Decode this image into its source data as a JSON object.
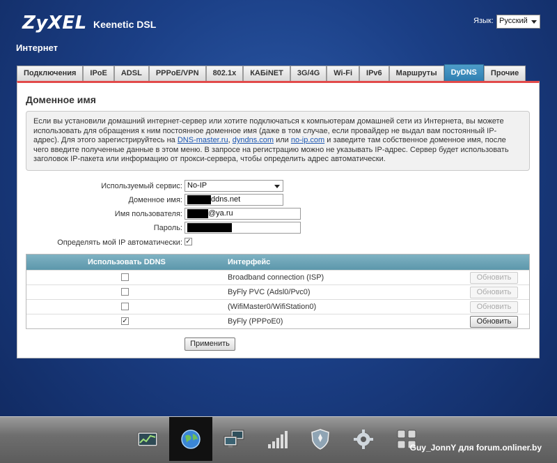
{
  "header": {
    "brand": "ZyXEL",
    "product": "Keenetic DSL",
    "language_label": "Язык:",
    "language_value": "Русский"
  },
  "page_title": "Интернет",
  "tabs": [
    {
      "label": "Подключения",
      "active": false
    },
    {
      "label": "IPoE",
      "active": false
    },
    {
      "label": "ADSL",
      "active": false
    },
    {
      "label": "PPPoE/VPN",
      "active": false
    },
    {
      "label": "802.1x",
      "active": false
    },
    {
      "label": "КАБiNET",
      "active": false
    },
    {
      "label": "3G/4G",
      "active": false
    },
    {
      "label": "Wi-Fi",
      "active": false
    },
    {
      "label": "IPv6",
      "active": false
    },
    {
      "label": "Маршруты",
      "active": false
    },
    {
      "label": "DyDNS",
      "active": true
    },
    {
      "label": "Прочие",
      "active": false
    }
  ],
  "panel": {
    "title": "Доменное имя",
    "info": {
      "text_1": "Если вы установили домашний интернет-сервер или хотите подключаться к компьютерам домашней сети из Интернета, вы можете использовать для обращения к ним постоянное доменное имя (даже в том случае, если провайдер не выдал вам постоянный IP-адрес). Для этого зарегистрируйтесь на ",
      "link_1": "DNS-master.ru",
      "sep_1": ", ",
      "link_2": "dyndns.com",
      "sep_2": " или ",
      "link_3": "no-ip.com",
      "text_2": " и заведите там собственное доменное имя, после чего введите полученные данные в этом меню. В запросе на регистрацию можно не указывать IP-адрес. Сервер будет использовать заголовок IP-пакета или информацию от прокси-сервера, чтобы определить адрес автоматически."
    },
    "form": {
      "service_label": "Используемый сервис:",
      "service_value": "No-IP",
      "domain_label": "Доменное имя:",
      "domain_suffix": "ddns.net",
      "username_label": "Имя пользователя:",
      "username_suffix": "@ya.ru",
      "password_label": "Пароль:",
      "auto_ip_label": "Определять мой IP автоматически:",
      "auto_ip_checked": true
    },
    "table": {
      "col_use": "Использовать DDNS",
      "col_iface": "Интерфейс",
      "rows": [
        {
          "use": false,
          "interface": "Broadband connection (ISP)",
          "button": "Обновить",
          "button_enabled": false
        },
        {
          "use": false,
          "interface": "ByFly PVC (Adsl0/Pvc0)",
          "button": "Обновить",
          "button_enabled": false
        },
        {
          "use": false,
          "interface": "(WifiMaster0/WifiStation0)",
          "button": "Обновить",
          "button_enabled": false
        },
        {
          "use": true,
          "interface": "ByFly (PPPoE0)",
          "button": "Обновить",
          "button_enabled": true
        }
      ]
    },
    "apply_label": "Применить"
  },
  "taskbar": {
    "items": [
      {
        "icon": "chart-icon",
        "active": false
      },
      {
        "icon": "globe-icon",
        "active": true
      },
      {
        "icon": "computers-icon",
        "active": false
      },
      {
        "icon": "signal-bars-icon",
        "active": false
      },
      {
        "icon": "shield-icon",
        "active": false
      },
      {
        "icon": "gear-icon",
        "active": false
      },
      {
        "icon": "apps-grid-icon",
        "active": false
      }
    ],
    "credit": "Guy_JonnY для forum.onliner.by"
  }
}
